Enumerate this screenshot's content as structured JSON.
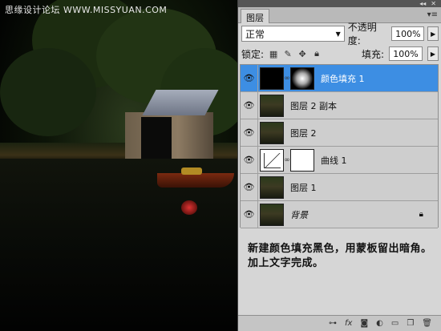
{
  "canvas": {
    "watermark": "思缘设计论坛 WWW.MISSYUAN.COM"
  },
  "panel": {
    "tab_label": "图层",
    "blend_mode": "正常",
    "opacity_label": "不透明度:",
    "opacity_value": "100%",
    "lock_label": "锁定:",
    "fill_label": "填充:",
    "fill_value": "100%"
  },
  "layers": [
    {
      "name": "颜色填充 1",
      "thumb": "black",
      "mask": "vignette",
      "selected": true
    },
    {
      "name": "图层 2 副本",
      "thumb": "photo"
    },
    {
      "name": "图层 2",
      "thumb": "photo"
    },
    {
      "name": "曲线 1",
      "thumb": "curves",
      "mask": "white"
    },
    {
      "name": "图层 1",
      "thumb": "photo"
    },
    {
      "name": "背景",
      "thumb": "photo",
      "locked": true
    }
  ],
  "note": "新建颜色填充黑色，用蒙板留出暗角。加上文字完成。",
  "footer_icons": [
    "link-icon",
    "fx-icon",
    "mask-icon",
    "adjustment-icon",
    "group-icon",
    "new-layer-icon",
    "trash-icon"
  ],
  "colors": {
    "selection": "#3d8ee3",
    "panel_bg": "#d6d6d6"
  }
}
